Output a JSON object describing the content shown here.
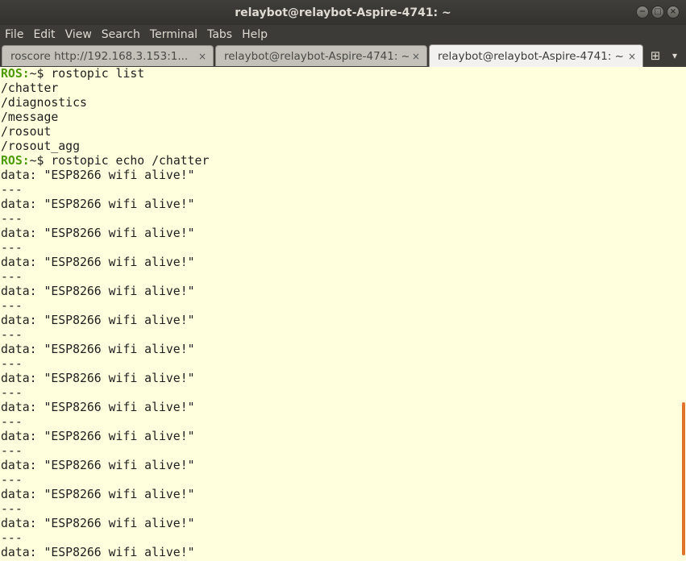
{
  "window": {
    "title": "relaybot@relaybot-Aspire-4741: ~",
    "buttons": [
      "−",
      "□",
      "×"
    ]
  },
  "menu": [
    "File",
    "Edit",
    "View",
    "Search",
    "Terminal",
    "Tabs",
    "Help"
  ],
  "tabs": [
    {
      "label": "roscore http://192.168.3.153:1...",
      "close": "×"
    },
    {
      "label": "relaybot@relaybot-Aspire-4741: ~",
      "close": "×"
    },
    {
      "label": "relaybot@relaybot-Aspire-4741: ~",
      "close": "×"
    }
  ],
  "tab_extras": {
    "new_tab_icon": "⊞",
    "dropdown_icon": "▾"
  },
  "terminal": {
    "prompt_user": "ROS:",
    "prompt_path": "~$ ",
    "commands": [
      "rostopic list",
      "rostopic echo /chatter"
    ],
    "topics": [
      "/chatter",
      "/diagnostics",
      "/message",
      "/rosout",
      "/rosout_agg"
    ],
    "echo_line": "data: \"ESP8266 wifi alive!\"",
    "separator": "---",
    "echo_count": 14
  },
  "colors": {
    "terminal_bg": "#ffffdd",
    "prompt": "#4e9a06",
    "scrollbar": "#e1742d"
  }
}
